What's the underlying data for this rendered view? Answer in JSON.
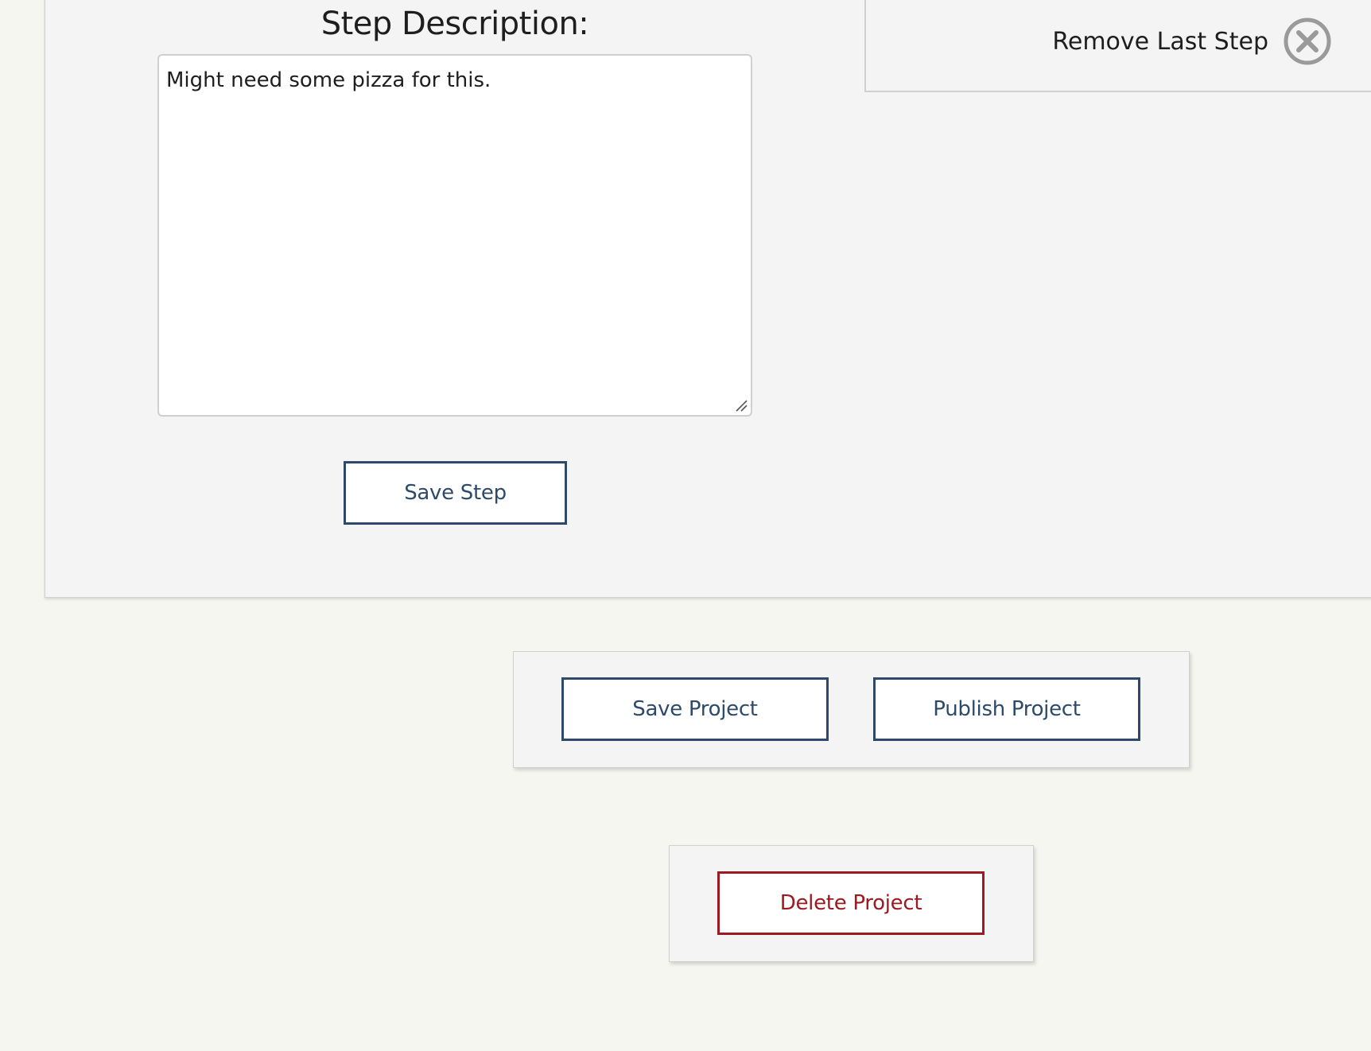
{
  "step": {
    "heading": "Step Description:",
    "description_value": "Might need some pizza for this.",
    "save_label": "Save Step"
  },
  "remove_step": {
    "label": "Remove Last Step",
    "icon": "close-circle-icon"
  },
  "project_actions": {
    "save_label": "Save Project",
    "publish_label": "Publish Project",
    "delete_label": "Delete Project"
  },
  "colors": {
    "page_background": "#f6f6f1",
    "panel_background": "#f4f4f4",
    "primary_button": "#2d4a6a",
    "danger_button": "#9c1a20"
  }
}
